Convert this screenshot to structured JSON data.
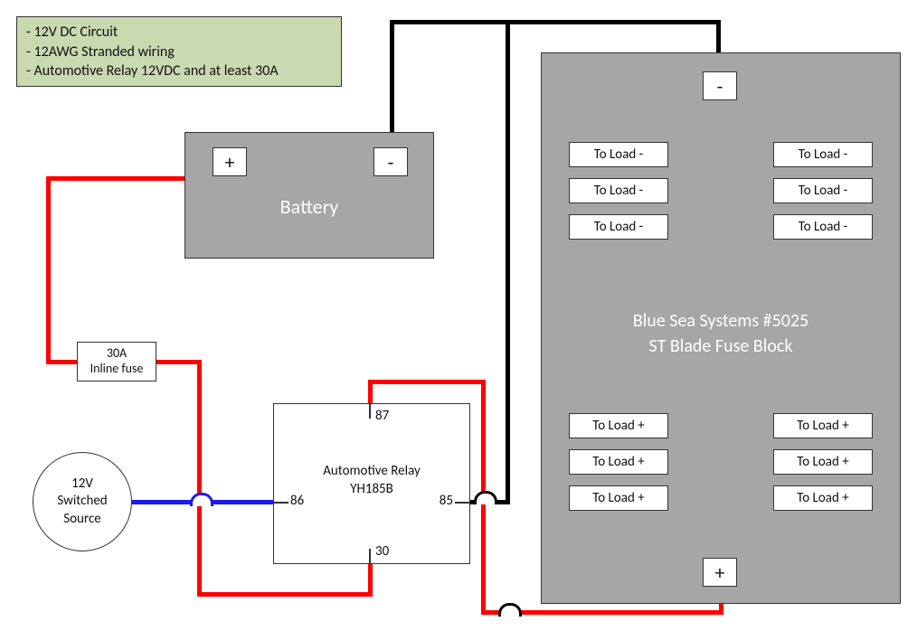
{
  "info": {
    "line1": "- 12V DC Circuit",
    "line2": "- 12AWG Stranded wiring",
    "line3": "- Automotive Relay 12VDC and at least 30A"
  },
  "battery": {
    "label": "Battery",
    "pos": "+",
    "neg": "-"
  },
  "fuse_block": {
    "title1": "Blue Sea Systems #5025",
    "title2": "ST Blade Fuse Block",
    "neg": "-",
    "pos": "+",
    "load_neg": "To Load -",
    "load_pos": "To Load +"
  },
  "inline_fuse": {
    "line1": "30A",
    "line2": "Inline fuse"
  },
  "relay": {
    "title1": "Automotive Relay",
    "title2": "YH185B",
    "pin87": "87",
    "pin86": "86",
    "pin85": "85",
    "pin30": "30"
  },
  "source": {
    "line1": "12V",
    "line2": "Switched",
    "line3": "Source"
  }
}
